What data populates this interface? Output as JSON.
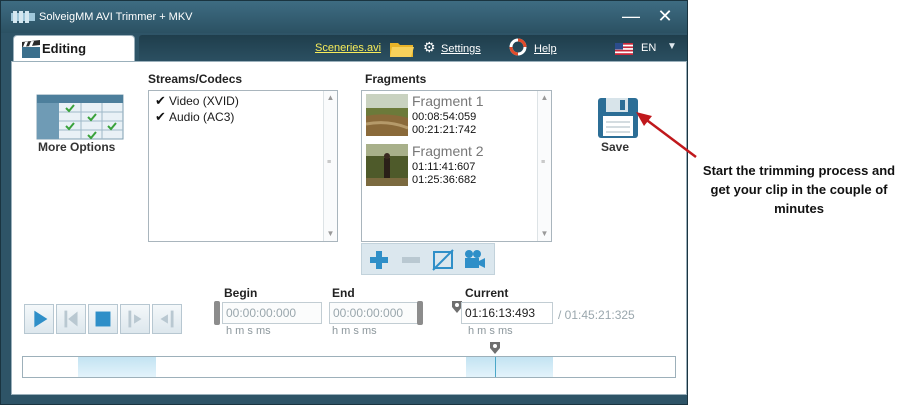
{
  "window": {
    "title": "SolveigMM AVI Trimmer + MKV",
    "minimize_label": "—",
    "close_label": "✕"
  },
  "tabs": {
    "editing_label": "Editing",
    "scenes_label": "Sceneries.avi",
    "settings_label": "Settings",
    "help_label": "Help",
    "language": "EN"
  },
  "more_options": {
    "label": "More Options"
  },
  "streams": {
    "heading": "Streams/Codecs",
    "items": [
      {
        "label": "Video (XVID)",
        "checked": true
      },
      {
        "label": "Audio (AC3)",
        "checked": true
      }
    ]
  },
  "fragments": {
    "heading": "Fragments",
    "items": [
      {
        "name": "Fragment 1",
        "start": "00:08:54:059",
        "end": "00:21:21:742"
      },
      {
        "name": "Fragment 2",
        "start": "01:11:41:607",
        "end": "01:25:36:682"
      }
    ]
  },
  "save": {
    "label": "Save"
  },
  "playback": {
    "begin_label": "Begin",
    "end_label": "End",
    "current_label": "Current",
    "begin_value": "00:00:00:000",
    "end_value": "00:00:00:000",
    "current_value": "01:16:13:493",
    "total": "/ 01:45:21:325",
    "units": "h  m  s   ms"
  },
  "timeline": {
    "cursor_fraction": 0.7235
  },
  "callout": {
    "text": "Start the trimming process and get your clip in the couple of minutes"
  },
  "colors": {
    "window_frame": "#2e5467",
    "scenes_link": "#f7ec5a",
    "annotation_arrow": "#c0181c",
    "timeline_range": "#c3e3f2"
  }
}
